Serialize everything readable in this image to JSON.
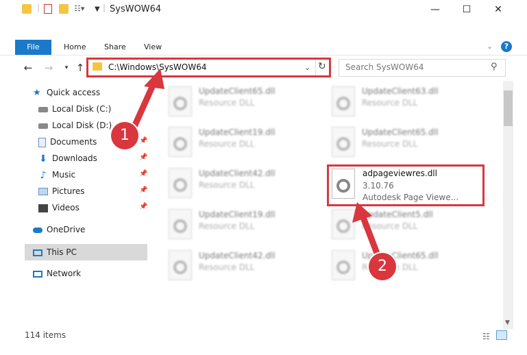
{
  "window": {
    "title": "SysWOW64",
    "minimize": "—",
    "maximize": "☐",
    "close": "✕"
  },
  "ribbon": {
    "file": "File",
    "home": "Home",
    "share": "Share",
    "view": "View"
  },
  "address": {
    "path": "C:\\Windows\\SysWOW64"
  },
  "search": {
    "placeholder": "Search SysWOW64"
  },
  "sidebar": {
    "quick_access": "Quick access",
    "items": [
      {
        "label": "Local Disk (C:)",
        "icon": "drive-icon"
      },
      {
        "label": "Local Disk (D:)",
        "icon": "drive-icon"
      },
      {
        "label": "Documents",
        "icon": "documents-icon"
      },
      {
        "label": "Downloads",
        "icon": "downloads-icon"
      },
      {
        "label": "Music",
        "icon": "music-icon"
      },
      {
        "label": "Pictures",
        "icon": "pictures-icon"
      },
      {
        "label": "Videos",
        "icon": "videos-icon"
      }
    ],
    "onedrive": "OneDrive",
    "thispc": "This PC",
    "network": "Network"
  },
  "files": {
    "left": [
      {
        "name": "UpdateClient65.dll",
        "desc": "Resource DLL"
      },
      {
        "name": "UpdateClient19.dll",
        "desc": "Resource DLL"
      },
      {
        "name": "UpdateClient42.dll",
        "desc": "Resource DLL"
      },
      {
        "name": "UpdateClient19.dll",
        "desc": "Resource DLL"
      },
      {
        "name": "UpdateClient42.dll",
        "desc": "Resource DLL"
      }
    ],
    "right": [
      {
        "name": "UpdateClient63.dll",
        "desc": "Resource DLL"
      },
      {
        "name": "UpdateClient65.dll",
        "desc": "Resource DLL"
      },
      {
        "name": "UpdateClient5.dll",
        "desc": "Resource DLL"
      },
      {
        "name": "UpdateClient65.dll",
        "desc": "Resource DLL"
      }
    ],
    "highlight": {
      "name": "adpageviewres.dll",
      "version": "3.10.76",
      "desc": "Autodesk Page Viewe..."
    }
  },
  "status": {
    "count": "114 items"
  },
  "callouts": {
    "one": "1",
    "two": "2"
  },
  "colors": {
    "accent": "#1979ca",
    "highlight": "#d9363e"
  }
}
